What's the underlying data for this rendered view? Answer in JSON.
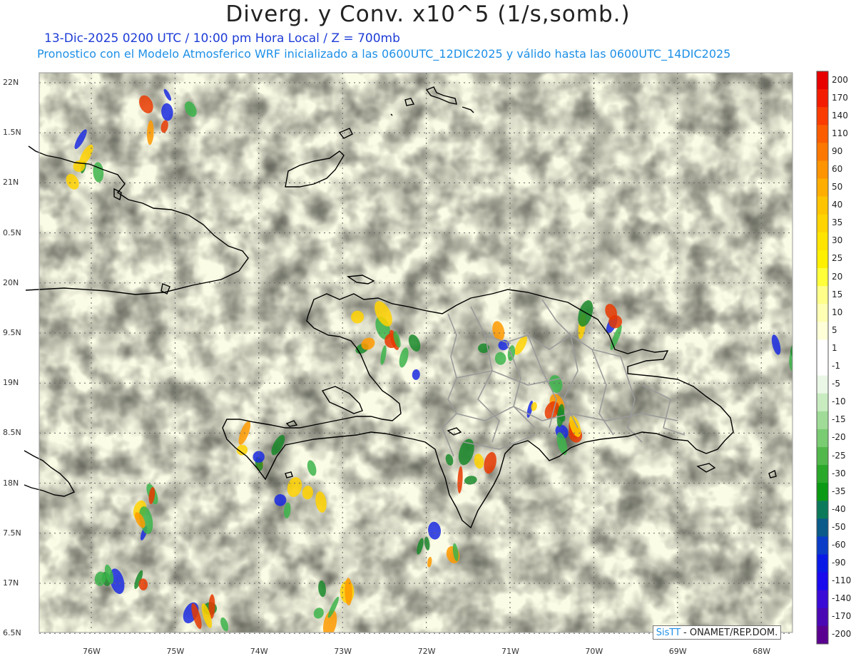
{
  "header": {
    "title": "Diverg. y Conv. x10^5 (1/s,somb.)",
    "subtitle_date": "13-Dic-2025  0200 UTC / 10:00 pm Hora Local / Z = 700mb",
    "subtitle_model": "Pronostico con el Modelo Atmosferico WRF inicializado a las 0600UTC_12DIC2025 y válido hasta las  0600UTC_14DIC2025"
  },
  "credit": {
    "brand": "SisTT",
    "text": "- ONAMET/REP.DOM."
  },
  "axes": {
    "lat_labels": [
      "22N",
      "1.5N",
      "21N",
      "0.5N",
      "20N",
      "9.5N",
      "19N",
      "8.5N",
      "18N",
      "7.5N",
      "17N",
      "6.5N"
    ],
    "lon_labels": [
      "76W",
      "75W",
      "74W",
      "73W",
      "72W",
      "71W",
      "70W",
      "69W",
      "68W"
    ]
  },
  "colorbar": {
    "labels": [
      "200",
      "170",
      "140",
      "110",
      "90",
      "60",
      "50",
      "40",
      "35",
      "30",
      "25",
      "20",
      "15",
      "10",
      "5",
      "1",
      "-1",
      "-5",
      "-10",
      "-15",
      "-20",
      "-25",
      "-30",
      "-35",
      "-40",
      "-50",
      "-60",
      "-90",
      "-110",
      "-140",
      "-170",
      "-200"
    ],
    "colors": [
      "#e80000",
      "#f41c00",
      "#fa3c00",
      "#fc5c00",
      "#fd7800",
      "#fd9400",
      "#ffae00",
      "#ffc400",
      "#ffd400",
      "#ffe400",
      "#fff000",
      "#ffff3a",
      "#ffff8a",
      "#ffffb4",
      "#ffffd8",
      "#ffffff",
      "#ffffff",
      "#eaf7e6",
      "#c8ecc0",
      "#a0dc98",
      "#7acc72",
      "#52b84c",
      "#2aa82a",
      "#0a9a14",
      "#0c7a5a",
      "#0a5a8a",
      "#0a3cc8",
      "#0a1ae6",
      "#1a0aee",
      "#3a0ad6",
      "#4a08b4",
      "#5a0090"
    ]
  },
  "colors": {
    "coast": "#000000",
    "provinces": "#9a9a9a",
    "grid": "#666666",
    "title_blue": "#1e3cd6",
    "subtitle_cyan": "#1e90e6"
  }
}
